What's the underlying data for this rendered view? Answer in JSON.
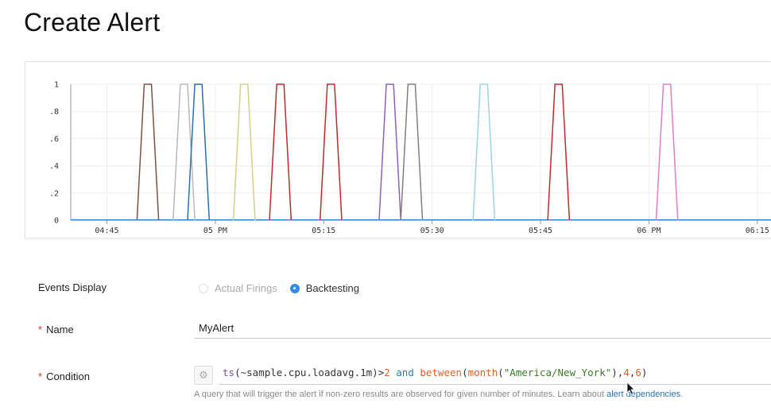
{
  "header": {
    "title": "Create Alert"
  },
  "chart_data": {
    "type": "line",
    "x_ticks": [
      "04:45",
      "05 PM",
      "05:15",
      "05:30",
      "05:45",
      "06 PM",
      "06:15"
    ],
    "y_ticks": [
      "0",
      ".2",
      ".4",
      ".6",
      ".8",
      "1"
    ],
    "ylim": [
      0,
      1
    ],
    "x_range_minutes": [
      "04:40",
      "06:17"
    ],
    "grid": true,
    "pulses": [
      {
        "start": "04:50:10",
        "end": "04:51:10",
        "value": 1,
        "color": "#7d5346"
      },
      {
        "start": "04:55:10",
        "end": "04:56:10",
        "value": 1,
        "color": "#b8b8b8"
      },
      {
        "start": "04:57:10",
        "end": "04:58:10",
        "value": 1,
        "color": "#2a6fb5"
      },
      {
        "start": "05:03:30",
        "end": "05:04:30",
        "value": 1,
        "color": "#d1d08a"
      },
      {
        "start": "05:08:30",
        "end": "05:09:30",
        "value": 1,
        "color": "#c02a2a"
      },
      {
        "start": "05:15:30",
        "end": "05:16:30",
        "value": 1,
        "color": "#c02a2a"
      },
      {
        "start": "05:23:40",
        "end": "05:24:40",
        "value": 1,
        "color": "#8e62b8"
      },
      {
        "start": "05:26:40",
        "end": "05:27:40",
        "value": 1,
        "color": "#7f7f7f"
      },
      {
        "start": "05:36:40",
        "end": "05:37:40",
        "value": 1,
        "color": "#9bd5e2"
      },
      {
        "start": "05:47:00",
        "end": "05:48:00",
        "value": 1,
        "color": "#c02a2a"
      },
      {
        "start": "06:02:00",
        "end": "06:03:00",
        "value": 1,
        "color": "#e07cc8"
      }
    ]
  },
  "events_display": {
    "label": "Events Display",
    "options": [
      {
        "label": "Actual Firings",
        "selected": false,
        "disabled": true
      },
      {
        "label": "Backtesting",
        "selected": true,
        "disabled": false
      }
    ]
  },
  "name_field": {
    "label": "Name",
    "value": "MyAlert"
  },
  "condition": {
    "label": "Condition",
    "tokens": [
      {
        "t": "ts",
        "c": "#7b50b0"
      },
      {
        "t": "(~sample.cpu.loadavg.1m)",
        "c": "#333333"
      },
      {
        "t": ">",
        "c": "#333333"
      },
      {
        "t": "2",
        "c": "#d8622a"
      },
      {
        "t": " ",
        "c": "#333333"
      },
      {
        "t": "and",
        "c": "#1f7fb0"
      },
      {
        "t": " ",
        "c": "#333333"
      },
      {
        "t": "between",
        "c": "#d8622a"
      },
      {
        "t": "(",
        "c": "#333333"
      },
      {
        "t": "month",
        "c": "#d8622a"
      },
      {
        "t": "(",
        "c": "#333333"
      },
      {
        "t": "\"America/New_York\"",
        "c": "#3d7a2a"
      },
      {
        "t": "),",
        "c": "#333333"
      },
      {
        "t": "4",
        "c": "#d8622a"
      },
      {
        "t": ",",
        "c": "#333333"
      },
      {
        "t": "6",
        "c": "#d8622a"
      },
      {
        "t": ")",
        "c": "#333333"
      }
    ],
    "hint_prefix": "A query that will trigger the alert if non-zero results are observed for given number of minutes. Learn about ",
    "hint_link": "alert dependencies",
    "hint_suffix": "."
  },
  "icons": {
    "settings": "gear-icon"
  },
  "colors": {
    "accent": "#2e8ee6",
    "required": "#d9342b",
    "link": "#2672b5"
  }
}
